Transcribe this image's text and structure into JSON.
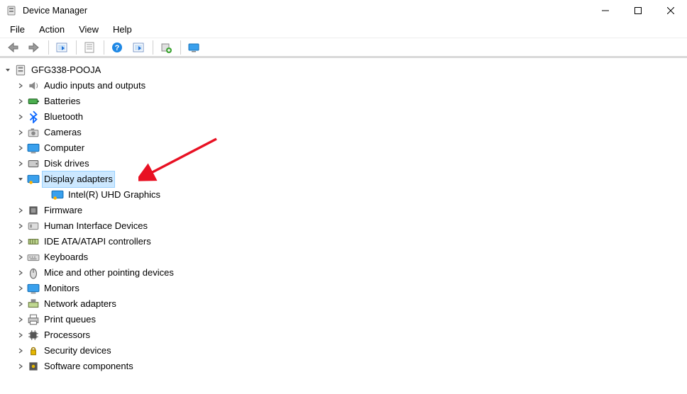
{
  "window": {
    "title": "Device Manager"
  },
  "menu": {
    "file": "File",
    "action": "Action",
    "view": "View",
    "help": "Help"
  },
  "root": {
    "name": "GFG338-POOJA"
  },
  "categories": [
    {
      "label": "Audio inputs and outputs",
      "icon": "audio"
    },
    {
      "label": "Batteries",
      "icon": "battery"
    },
    {
      "label": "Bluetooth",
      "icon": "bluetooth"
    },
    {
      "label": "Cameras",
      "icon": "camera"
    },
    {
      "label": "Computer",
      "icon": "computer"
    },
    {
      "label": "Disk drives",
      "icon": "disk"
    },
    {
      "label": "Display adapters",
      "icon": "display",
      "selected": true,
      "expanded": true
    },
    {
      "label": "Firmware",
      "icon": "firmware"
    },
    {
      "label": "Human Interface Devices",
      "icon": "hid"
    },
    {
      "label": "IDE ATA/ATAPI controllers",
      "icon": "ide"
    },
    {
      "label": "Keyboards",
      "icon": "keyboard"
    },
    {
      "label": "Mice and other pointing devices",
      "icon": "mouse"
    },
    {
      "label": "Monitors",
      "icon": "monitor"
    },
    {
      "label": "Network adapters",
      "icon": "network"
    },
    {
      "label": "Print queues",
      "icon": "printer"
    },
    {
      "label": "Processors",
      "icon": "processor"
    },
    {
      "label": "Security devices",
      "icon": "security"
    },
    {
      "label": "Software components",
      "icon": "software"
    }
  ],
  "display_child": {
    "label": "Intel(R) UHD Graphics"
  },
  "annotation": {
    "arrow_color": "#e81123"
  }
}
